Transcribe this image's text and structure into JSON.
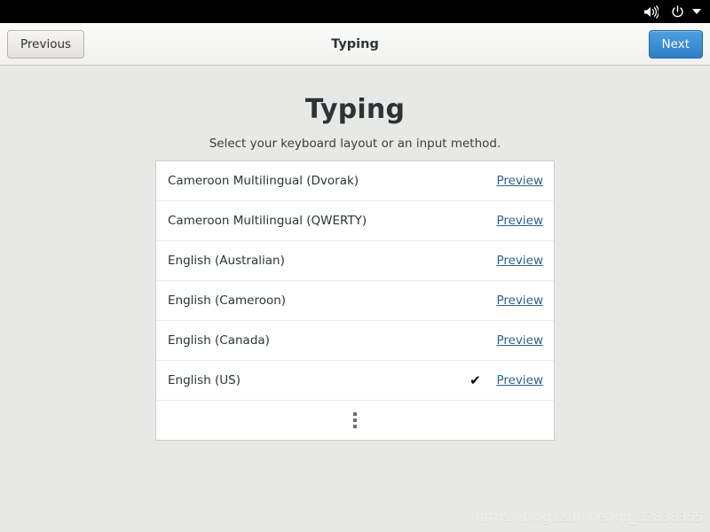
{
  "system_bar": {
    "icons": [
      {
        "name": "volume-icon",
        "label": "Volume"
      },
      {
        "name": "power-icon",
        "label": "Power"
      },
      {
        "name": "chevron-down-icon",
        "label": "System menu"
      }
    ]
  },
  "header": {
    "title": "Typing",
    "previous_label": "Previous",
    "next_label": "Next",
    "next_accent_color": "#2d80c6"
  },
  "page": {
    "heading": "Typing",
    "subtitle": "Select your keyboard layout or an input method."
  },
  "layout_list": {
    "preview_label": "Preview",
    "check_glyph": "✔",
    "rows": [
      {
        "label": "Cameroon Multilingual (Dvorak)",
        "selected": false
      },
      {
        "label": "Cameroon Multilingual (QWERTY)",
        "selected": false
      },
      {
        "label": "English (Australian)",
        "selected": false
      },
      {
        "label": "English (Cameroon)",
        "selected": false
      },
      {
        "label": "English (Canada)",
        "selected": false
      },
      {
        "label": "English (US)",
        "selected": true
      }
    ]
  },
  "watermark": {
    "text": "https://blog.csdn.net/qq_32838955"
  }
}
